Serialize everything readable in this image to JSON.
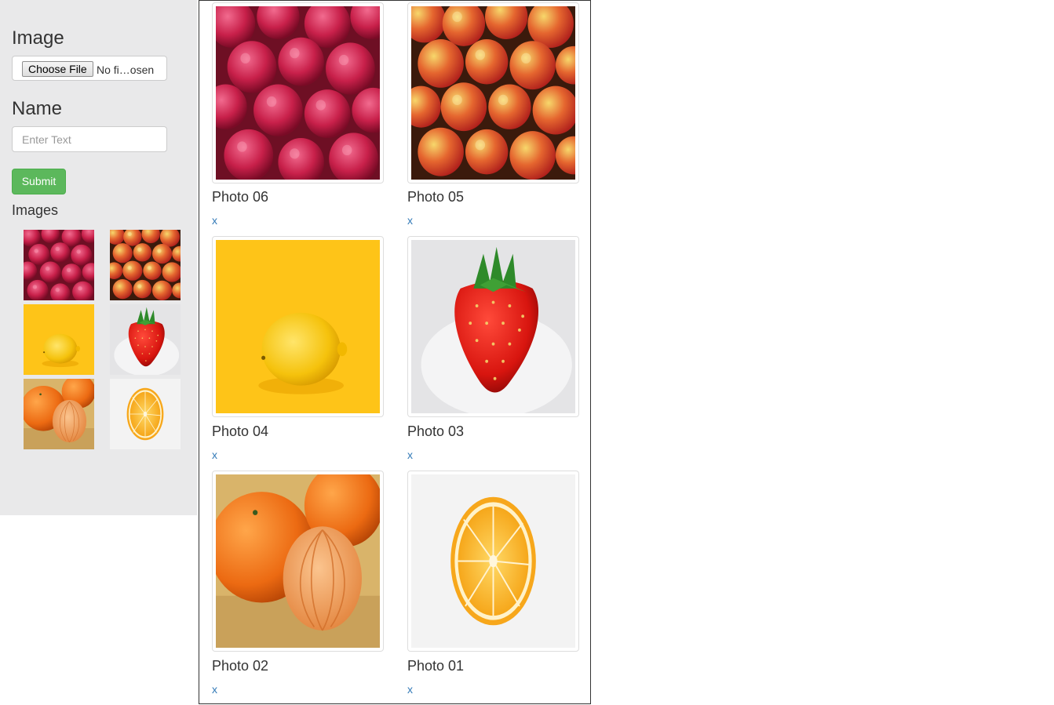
{
  "form": {
    "image_label": "Image",
    "file_button_label": "Choose File",
    "file_status": "No fi…osen",
    "name_label": "Name",
    "name_placeholder": "Enter Text",
    "submit_label": "Submit",
    "images_label": "Images"
  },
  "thumbnails": [
    {
      "subject": "raspberries"
    },
    {
      "subject": "apples"
    },
    {
      "subject": "lemon"
    },
    {
      "subject": "strawberry"
    },
    {
      "subject": "tangerines"
    },
    {
      "subject": "orange-slice"
    }
  ],
  "gallery": [
    {
      "caption": "Photo 06",
      "remove": "x",
      "subject": "raspberries"
    },
    {
      "caption": "Photo 05",
      "remove": "x",
      "subject": "apples"
    },
    {
      "caption": "Photo 04",
      "remove": "x",
      "subject": "lemon"
    },
    {
      "caption": "Photo 03",
      "remove": "x",
      "subject": "strawberry"
    },
    {
      "caption": "Photo 02",
      "remove": "x",
      "subject": "tangerines"
    },
    {
      "caption": "Photo 01",
      "remove": "x",
      "subject": "orange-slice"
    }
  ],
  "colors": {
    "sidebar_bg": "#e9e9ea",
    "submit_green": "#5cb85c",
    "link_blue": "#337ab7"
  }
}
